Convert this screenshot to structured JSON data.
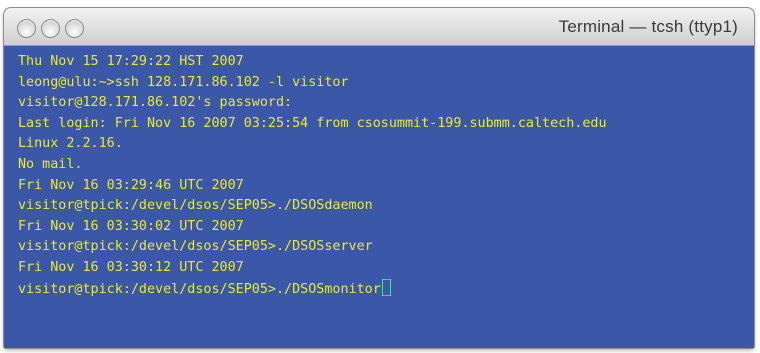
{
  "window": {
    "title": "Terminal — tcsh (ttyp1)"
  },
  "colors": {
    "terminal_background": "#3b58a8",
    "terminal_text": "#eaea2a",
    "cursor": "#22ff55"
  },
  "terminal": {
    "lines": [
      "Thu Nov 15 17:29:22 HST 2007",
      "leong@ulu:~>ssh 128.171.86.102 -l visitor",
      "visitor@128.171.86.102's password:",
      "Last login: Fri Nov 16 2007 03:25:54 from csosummit-199.submm.caltech.edu",
      "Linux 2.2.16.",
      "No mail.",
      "Fri Nov 16 03:29:46 UTC 2007",
      "visitor@tpick:/devel/dsos/SEP05>./DSOSdaemon",
      "Fri Nov 16 03:30:02 UTC 2007",
      "visitor@tpick:/devel/dsos/SEP05>./DSOSserver",
      "Fri Nov 16 03:30:12 UTC 2007",
      "visitor@tpick:/devel/dsos/SEP05>./DSOSmonitor"
    ]
  }
}
